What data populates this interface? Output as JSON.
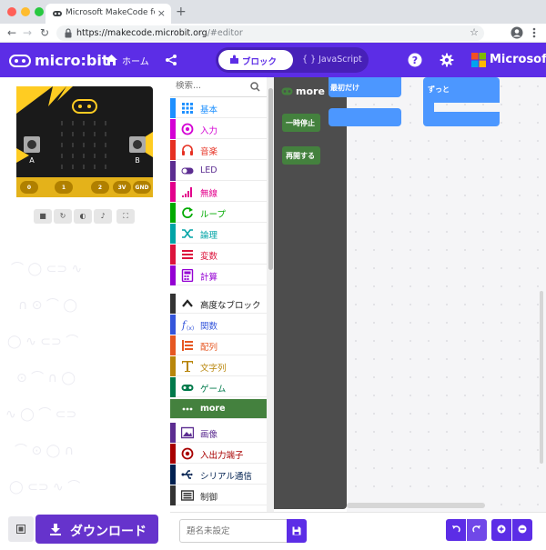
{
  "browser": {
    "tab_title": "Microsoft MakeCode for micro:bit",
    "url_host": "https://makecode.microbit.org",
    "url_path": "/#editor",
    "close_glyph": "×",
    "new_tab_glyph": "+",
    "back_glyph": "←",
    "forward_glyph": "→",
    "reload_glyph": "↻",
    "star_glyph": "☆"
  },
  "header": {
    "logo_text": "micro:bit",
    "home_label": "ホーム",
    "blocks_label": "ブロック",
    "javascript_label": "{ } JavaScript",
    "brand_label": "Microsoft",
    "accent_color": "#5c2de6"
  },
  "simulator": {
    "buttons": [
      "■",
      "↻",
      "◐",
      "♪",
      "⛶"
    ],
    "pins": [
      "0",
      "1",
      "2",
      "3V",
      "GND"
    ],
    "button_a": "A",
    "button_b": "B"
  },
  "toolbox": {
    "search_placeholder": "検索...",
    "categories": [
      {
        "label": "基本",
        "color": "#1e90ff",
        "icon": "grid-icon"
      },
      {
        "label": "入力",
        "color": "#d400d4",
        "icon": "target-icon"
      },
      {
        "label": "音楽",
        "color": "#e63022",
        "icon": "headphones-icon"
      },
      {
        "label": "LED",
        "color": "#5c2d91",
        "icon": "toggle-icon"
      },
      {
        "label": "無線",
        "color": "#e3008c",
        "icon": "signal-icon"
      },
      {
        "label": "ループ",
        "color": "#00aa00",
        "icon": "loop-icon"
      },
      {
        "label": "論理",
        "color": "#00a4a6",
        "icon": "shuffle-icon"
      },
      {
        "label": "変数",
        "color": "#dc143c",
        "icon": "lines-icon"
      },
      {
        "label": "計算",
        "color": "#9400d3",
        "icon": "calculator-icon"
      },
      {
        "label": "高度なブロック",
        "color": "#333333",
        "icon": "chevron-up-icon"
      },
      {
        "label": "関数",
        "color": "#3455db",
        "icon": "function-icon"
      },
      {
        "label": "配列",
        "color": "#e65722",
        "icon": "list-icon"
      },
      {
        "label": "文字列",
        "color": "#b8860b",
        "icon": "text-icon"
      },
      {
        "label": "ゲーム",
        "color": "#007a4b",
        "icon": "gamepad-icon"
      },
      {
        "label": "more",
        "color": "#44813e",
        "icon": "dots-icon"
      },
      {
        "label": "画像",
        "color": "#5c2d91",
        "icon": "image-icon"
      },
      {
        "label": "入出力端子",
        "color": "#a80000",
        "icon": "pin-icon"
      },
      {
        "label": "シリアル通信",
        "color": "#002050",
        "icon": "usb-icon"
      },
      {
        "label": "制御",
        "color": "#333333",
        "icon": "control-icon"
      }
    ],
    "selected_index": 14
  },
  "flyout": {
    "title": "more",
    "blocks": [
      "一時停止",
      "再開する"
    ]
  },
  "workspace": {
    "block_color": "#4c97ff",
    "on_start_label": "最初だけ",
    "forever_label": "ずっと"
  },
  "bottom": {
    "download_label": "ダウンロード",
    "project_name_placeholder": "題名未設定"
  }
}
